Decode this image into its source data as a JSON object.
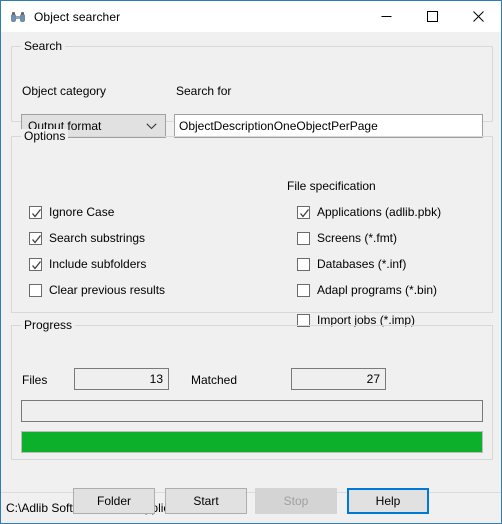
{
  "window": {
    "title": "Object searcher",
    "icon": "binoculars-icon",
    "border_color": "#2f7cb5",
    "controls": {
      "minimize": "minimize-icon",
      "maximize": "maximize-icon",
      "close": "close-icon"
    }
  },
  "search_group": {
    "legend": "Search",
    "category_label": "Object category",
    "category_value": "Output format",
    "search_for_label": "Search for",
    "search_for_value": "ObjectDescriptionOneObjectPerPage",
    "search_for_placeholder": ""
  },
  "options_group": {
    "legend": "Options",
    "items": [
      {
        "label": "Ignore Case",
        "checked": true
      },
      {
        "label": "Search substrings",
        "checked": true
      },
      {
        "label": "Include subfolders",
        "checked": true
      },
      {
        "label": "Clear previous results",
        "checked": false
      }
    ]
  },
  "file_spec_group": {
    "legend": "File specification",
    "items": [
      {
        "label": "Applications (adlib.pbk)",
        "checked": true
      },
      {
        "label": "Screens (*.fmt)",
        "checked": false
      },
      {
        "label": "Databases (*.inf)",
        "checked": false
      },
      {
        "label": "Adapl programs (*.bin)",
        "checked": false
      },
      {
        "label": "Import jobs (*.imp)",
        "checked": false
      }
    ]
  },
  "progress_group": {
    "legend": "Progress",
    "files_label": "Files",
    "files_value": "13",
    "matched_label": "Matched",
    "matched_value": "27",
    "status_value": "",
    "bar_percent": 100,
    "bar_color": "#0db02b"
  },
  "buttons": {
    "folder": "Folder",
    "start": "Start",
    "stop": "Stop",
    "help": "Help",
    "focus_color": "#0078d7"
  },
  "statusbar": {
    "path": "C:\\Adlib Software\\Model application 4.5\\4.5"
  }
}
